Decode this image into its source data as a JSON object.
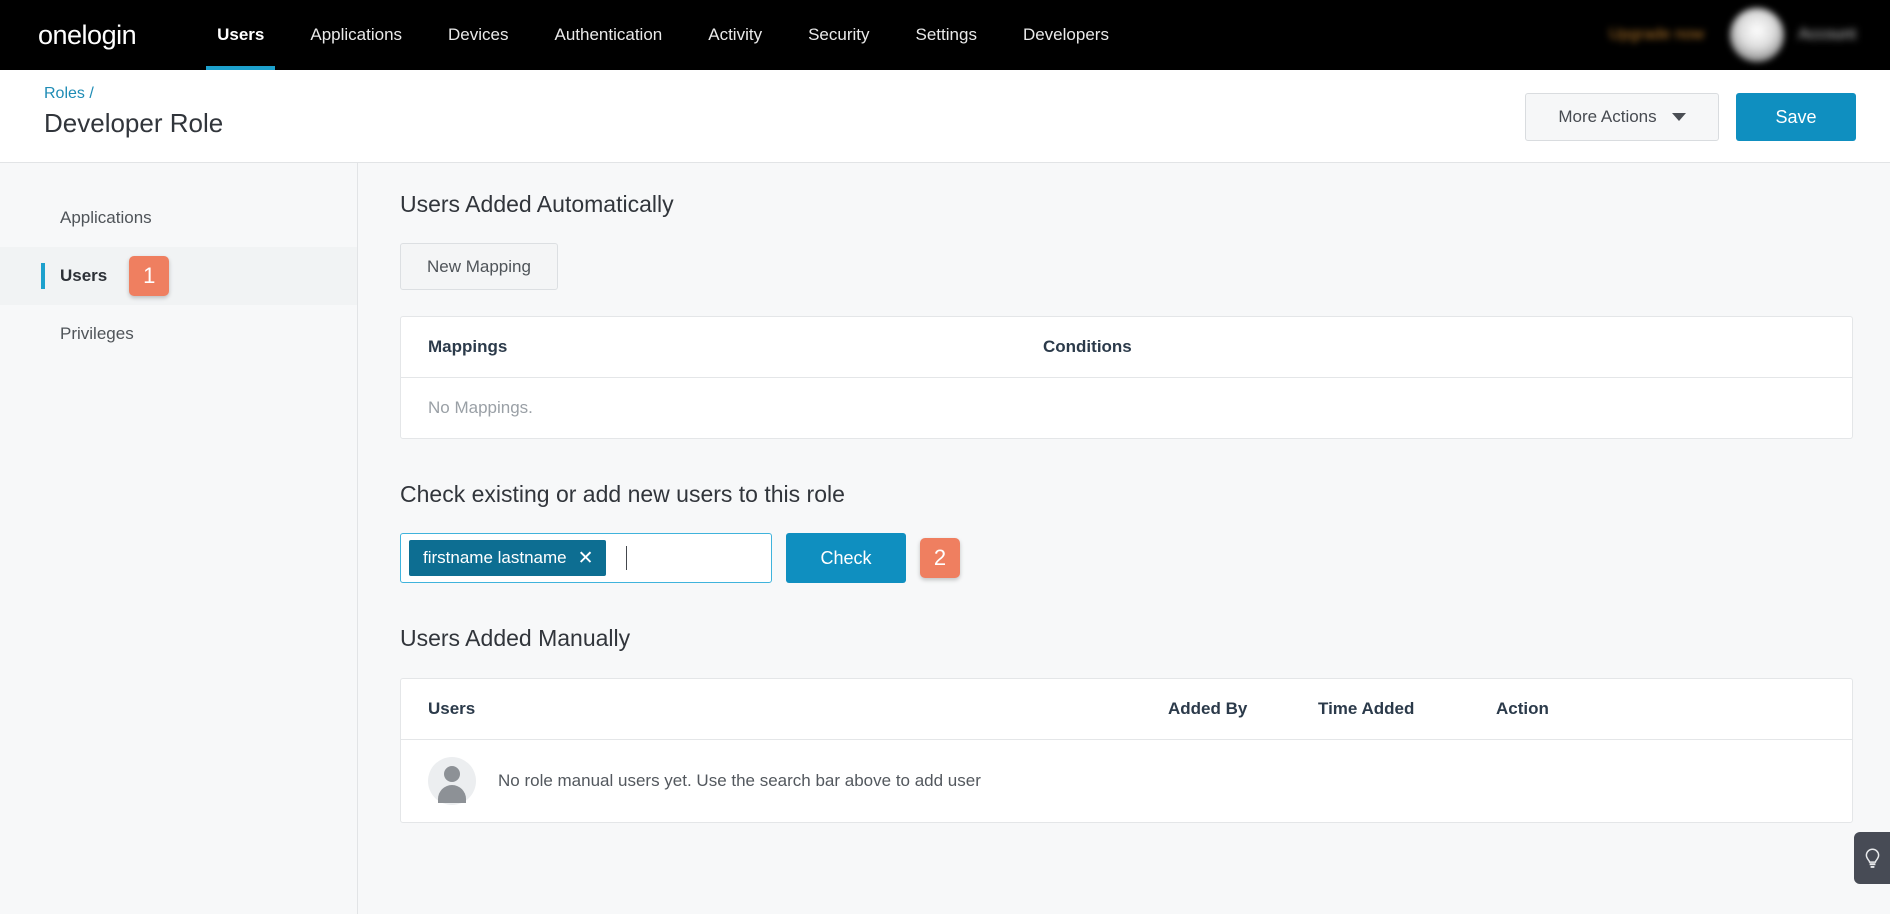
{
  "topnav": {
    "brand": "onelogin",
    "items": [
      {
        "label": "Users",
        "active": true
      },
      {
        "label": "Applications",
        "active": false
      },
      {
        "label": "Devices",
        "active": false
      },
      {
        "label": "Authentication",
        "active": false
      },
      {
        "label": "Activity",
        "active": false
      },
      {
        "label": "Security",
        "active": false
      },
      {
        "label": "Settings",
        "active": false
      },
      {
        "label": "Developers",
        "active": false
      }
    ],
    "upgrade_label": "Upgrade now",
    "account_name": "Account",
    "accent_color": "#1da1cd",
    "background_color": "#000000"
  },
  "pagehead": {
    "breadcrumb_link": "Roles",
    "breadcrumb_separator": "/",
    "title": "Developer Role",
    "more_actions_label": "More Actions",
    "save_label": "Save",
    "save_color": "#0f8fc0"
  },
  "sidebar": {
    "items": [
      {
        "label": "Applications",
        "active": false,
        "badge": null
      },
      {
        "label": "Users",
        "active": true,
        "badge": "1"
      },
      {
        "label": "Privileges",
        "active": false,
        "badge": null
      }
    ],
    "badge_color": "#ef7f60"
  },
  "main": {
    "auto_section": {
      "title": "Users Added Automatically",
      "new_mapping_label": "New Mapping",
      "table": {
        "headers": [
          "Mappings",
          "Conditions"
        ],
        "empty_text": "No Mappings."
      }
    },
    "check_section": {
      "title": "Check existing or add new users to this role",
      "chip_label": "firstname lastname",
      "chip_remove_icon": "✕",
      "chip_color": "#0d6e92",
      "input_value": "",
      "input_placeholder": "",
      "check_label": "Check",
      "step_badge": "2"
    },
    "manual_section": {
      "title": "Users Added Manually",
      "table": {
        "headers": [
          "Users",
          "Added By",
          "Time Added",
          "Action"
        ],
        "empty_text": "No role manual users yet. Use the search bar above to add user"
      }
    }
  },
  "help": {
    "icon": "lightbulb-icon"
  }
}
